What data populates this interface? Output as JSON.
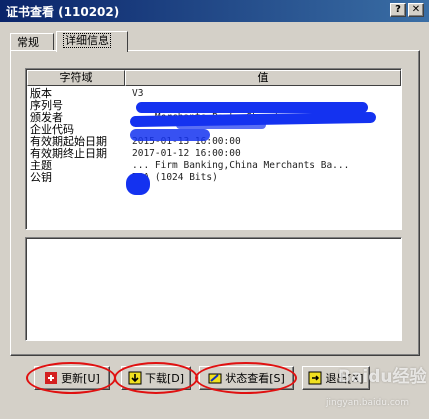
{
  "window": {
    "title": "证书查看 (110202)",
    "help_glyph": "?",
    "close_glyph": "✕"
  },
  "tabs": [
    {
      "label": "常规",
      "active": false
    },
    {
      "label": "详细信息",
      "active": true
    }
  ],
  "details_list": {
    "columns": [
      "字符域",
      "值"
    ],
    "rows": [
      {
        "field": "版本",
        "value": "V3"
      },
      {
        "field": "序列号",
        "value": ""
      },
      {
        "field": "颁发者",
        "value": "... Merchants Bank, Shenzhen, ..."
      },
      {
        "field": "企业代码",
        "value": ""
      },
      {
        "field": "有效期起始日期",
        "value": "2015-01-13 16:00:00"
      },
      {
        "field": "有效期终止日期",
        "value": "2017-01-12 16:00:00"
      },
      {
        "field": "主题",
        "value": "... Firm Banking,China Merchants Ba..."
      },
      {
        "field": "公钥",
        "value": "RSA (1024 Bits)"
      }
    ]
  },
  "buttons": {
    "update": "更新[U]",
    "download": "下载[D]",
    "status": "状态查看[S]",
    "exit": "退出[X]"
  },
  "colors": {
    "redaction": "#1432f0",
    "highlight_ellipse": "#e01010"
  },
  "watermark": {
    "text": "Baidu经验",
    "url": "jingyan.baidu.com"
  }
}
